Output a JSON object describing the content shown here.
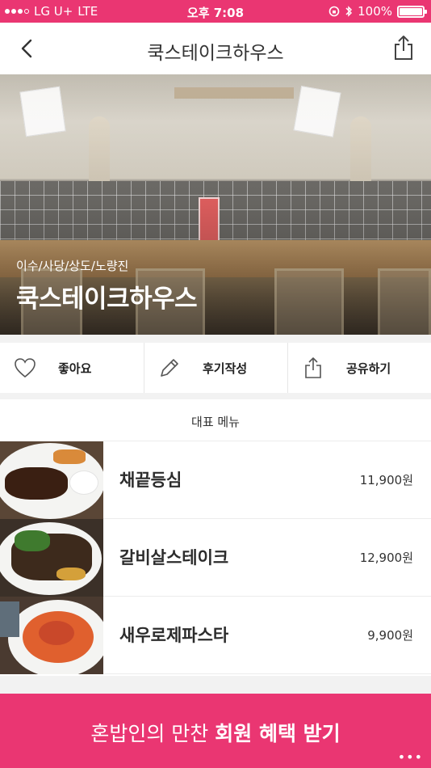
{
  "status_bar": {
    "carrier": "LG U+",
    "network": "LTE",
    "time": "오후 7:08",
    "battery": "100%"
  },
  "nav": {
    "title": "쿡스테이크하우스",
    "back_icon": "chevron-left-icon",
    "share_icon": "share-icon"
  },
  "hero": {
    "area": "이수/사당/상도/노량진",
    "name": "쿡스테이크하우스"
  },
  "actions": [
    {
      "label": "좋아요",
      "icon": "heart-icon"
    },
    {
      "label": "후기작성",
      "icon": "pencil-icon"
    },
    {
      "label": "공유하기",
      "icon": "share-icon"
    }
  ],
  "menu": {
    "header": "대표 메뉴",
    "items": [
      {
        "name": "채끝등심",
        "price": "11,900원"
      },
      {
        "name": "갈비살스테이크",
        "price": "12,900원"
      },
      {
        "name": "새우로제파스타",
        "price": "9,900원"
      }
    ]
  },
  "cta": {
    "text_regular": "혼밥인의 만찬 ",
    "text_bold": "회원 혜택 받기",
    "more_label": "•••"
  },
  "colors": {
    "accent": "#ea3672",
    "text": "#222222",
    "divider": "#ececec"
  }
}
